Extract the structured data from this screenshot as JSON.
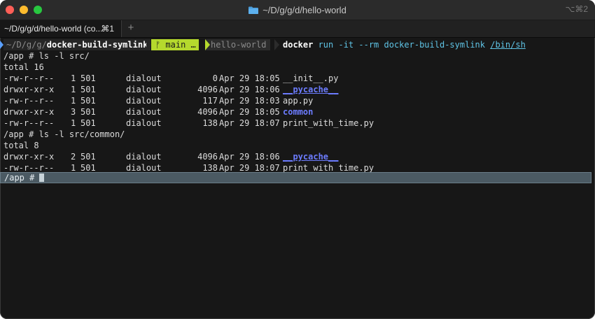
{
  "window": {
    "title": "~/D/g/g/d/hello-world",
    "shortcut": "⌥⌘2"
  },
  "tab": {
    "label": "~/D/g/g/d/hello-world (co...",
    "shortcut": "⌘1",
    "new_tab": "+"
  },
  "prompt": {
    "path_prefix": "~/D/g/g/",
    "path_bold": "docker-build-symlink",
    "branch": "ᚠ main …",
    "workdir": "hello-world",
    "command": "docker",
    "args": " run -it --rm docker-build-symlink ",
    "args_link": "/bin/sh"
  },
  "output": {
    "cmd1": "/app # ls -l src/",
    "total1": "total 16",
    "listing1": [
      {
        "perms": "-rw-r--r--",
        "links": "1",
        "owner": "501",
        "group": "dialout",
        "size": "0",
        "date": "Apr 29 18:05",
        "name": "__init__.py",
        "kind": "file"
      },
      {
        "perms": "drwxr-xr-x",
        "links": "1",
        "owner": "501",
        "group": "dialout",
        "size": "4096",
        "date": "Apr 29 18:06",
        "name": "__pycache__",
        "kind": "dir-u"
      },
      {
        "perms": "-rw-r--r--",
        "links": "1",
        "owner": "501",
        "group": "dialout",
        "size": "117",
        "date": "Apr 29 18:03",
        "name": "app.py",
        "kind": "file"
      },
      {
        "perms": "drwxr-xr-x",
        "links": "3",
        "owner": "501",
        "group": "dialout",
        "size": "4096",
        "date": "Apr 29 18:05",
        "name": "common",
        "kind": "dir"
      },
      {
        "perms": "-rw-r--r--",
        "links": "1",
        "owner": "501",
        "group": "dialout",
        "size": "138",
        "date": "Apr 29 18:07",
        "name": "print_with_time.py",
        "kind": "file"
      }
    ],
    "cmd2": "/app # ls -l src/common/",
    "total2": "total 8",
    "listing2": [
      {
        "perms": "drwxr-xr-x",
        "links": "2",
        "owner": "501",
        "group": "dialout",
        "size": "4096",
        "date": "Apr 29 18:06",
        "name": "__pycache__",
        "kind": "dir-u"
      },
      {
        "perms": "-rw-r--r--",
        "links": "1",
        "owner": "501",
        "group": "dialout",
        "size": "138",
        "date": "Apr 29 18:07",
        "name": "print_with_time.py",
        "kind": "file"
      }
    ],
    "current_prompt": "/app # "
  },
  "colors": {
    "branch_bg": "#b5d92d",
    "dir": "#6c7cff",
    "arg": "#5fc4e6",
    "current_line_bg": "#4b5a63"
  }
}
